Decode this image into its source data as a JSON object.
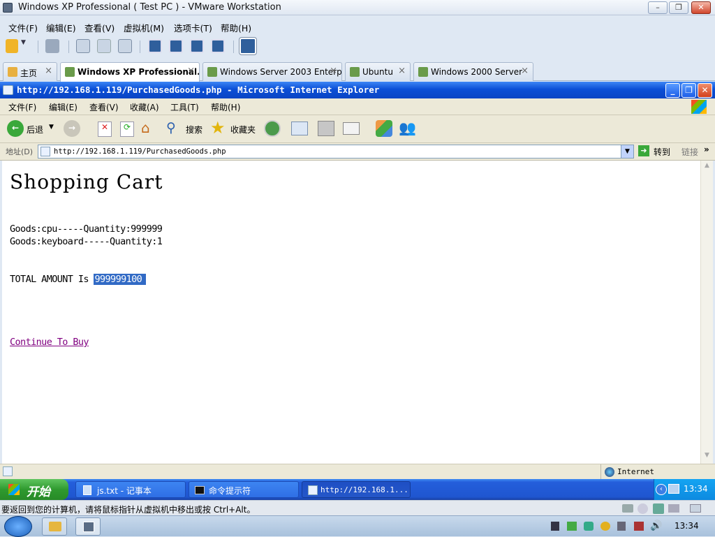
{
  "vmware": {
    "title": "Windows XP Professional ( Test PC ) - VMware Workstation",
    "menu": [
      "文件(F)",
      "编辑(E)",
      "查看(V)",
      "虚拟机(M)",
      "选项卡(T)",
      "帮助(H)"
    ],
    "tabs": [
      {
        "label": "主页",
        "active": false
      },
      {
        "label": "Windows XP Professional...",
        "active": true
      },
      {
        "label": "Windows Server 2003 Enterpr...",
        "active": false
      },
      {
        "label": "Ubuntu",
        "active": false
      },
      {
        "label": "Windows 2000 Server",
        "active": false
      }
    ],
    "tab_close": "×",
    "status_text": "要返回到您的计算机，请将鼠标指针从虚拟机中移出或按 Ctrl+Alt。"
  },
  "ie": {
    "title": "http://192.168.1.119/PurchasedGoods.php - Microsoft Internet Explorer",
    "menu": [
      "文件(F)",
      "编辑(E)",
      "查看(V)",
      "收藏(A)",
      "工具(T)",
      "帮助(H)"
    ],
    "toolbar": {
      "back": "后退",
      "search": "搜索",
      "favorites": "收藏夹"
    },
    "address_label": "地址(D)",
    "address_url": "http://192.168.1.119/PurchasedGoods.php",
    "go_label": "转到",
    "links_label": "链接",
    "status_zone": "Internet"
  },
  "page": {
    "heading": "Shopping Cart",
    "goods_lines": [
      "Goods:cpu-----Quantity:999999",
      "Goods:keyboard-----Quantity:1"
    ],
    "total_prefix": "TOTAL AMOUNT Is",
    "total_value": "999999100",
    "continue_link": "Continue To Buy"
  },
  "guest_taskbar": {
    "start_label": "开始",
    "tasks": [
      {
        "label": "js.txt - 记事本",
        "active": false
      },
      {
        "label": "命令提示符",
        "active": false
      },
      {
        "label": "http://192.168.1...",
        "active": true
      }
    ],
    "clock": "13:34"
  },
  "host_taskbar": {
    "clock": "13:34"
  },
  "colors": {
    "xp_blue": "#0b4fd6",
    "selection": "#316ac5",
    "link_visited": "#800080"
  }
}
